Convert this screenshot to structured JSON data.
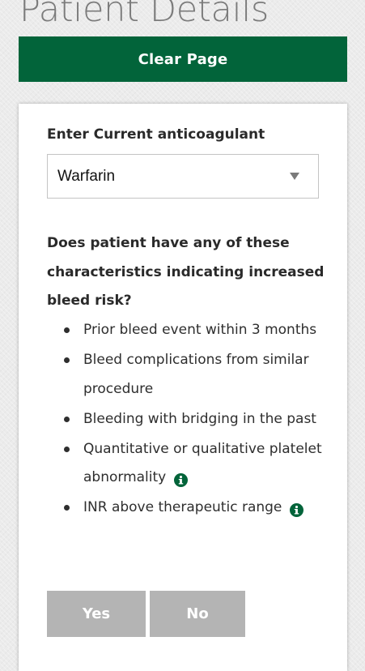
{
  "page": {
    "title": "Patient Details"
  },
  "toolbar": {
    "clear_label": "Clear Page"
  },
  "colors": {
    "accent": "#02643a",
    "button_disabled": "#b4b4b4",
    "background": "#ebebeb"
  },
  "anticoagulant": {
    "label": "Enter Current anticoagulant",
    "selected": "Warfarin"
  },
  "bleed_risk": {
    "question": "Does patient have any of these characteristics indicating increased bleed risk?",
    "items": [
      {
        "text": "Prior bleed event within 3 months",
        "info_icon": null
      },
      {
        "text": "Bleed complications from similar procedure",
        "info_icon": null
      },
      {
        "text": "Bleeding with bridging in the past",
        "info_icon": null
      },
      {
        "text": "Quantitative or qualitative platelet abnormality",
        "info_icon": "info-circle-icon"
      },
      {
        "text": "INR above therapeutic range",
        "info_icon": "info-circle-icon"
      }
    ],
    "yes_label": "Yes",
    "no_label": "No"
  }
}
